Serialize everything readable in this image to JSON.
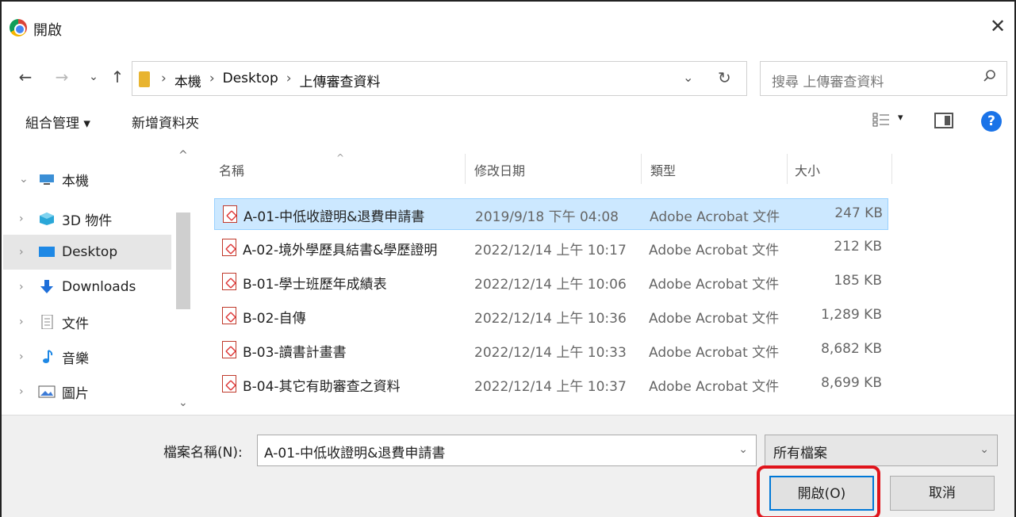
{
  "window": {
    "title": "開啟"
  },
  "address": {
    "crumbs": [
      "本機",
      "Desktop",
      "上傳審查資料"
    ],
    "separator": "›"
  },
  "search": {
    "placeholder": "搜尋 上傳審查資料"
  },
  "toolbar": {
    "organize_label": "組合管理 ▾",
    "new_folder_label": "新增資料夾"
  },
  "nav_tree": [
    {
      "label": "本機",
      "icon": "pc-icon"
    },
    {
      "label": "3D 物件",
      "icon": "cube-3d-icon"
    },
    {
      "label": "Desktop",
      "icon": "desktop-icon",
      "selected": true
    },
    {
      "label": "Downloads",
      "icon": "download-arrow-icon"
    },
    {
      "label": "文件",
      "icon": "document-icon"
    },
    {
      "label": "音樂",
      "icon": "music-note-icon"
    },
    {
      "label": "圖片",
      "icon": "picture-icon"
    }
  ],
  "columns": {
    "name": "名稱",
    "date": "修改日期",
    "type": "類型",
    "size": "大小"
  },
  "files": [
    {
      "name": "A-01-中低收證明&退費申請書",
      "date": "2019/9/18 下午 04:08",
      "type": "Adobe Acrobat 文件",
      "size": "247 KB",
      "selected": true
    },
    {
      "name": "A-02-境外學歷具結書&學歷證明",
      "date": "2022/12/14 上午 10:17",
      "type": "Adobe Acrobat 文件",
      "size": "212 KB"
    },
    {
      "name": "B-01-學士班歷年成績表",
      "date": "2022/12/14 上午 10:06",
      "type": "Adobe Acrobat 文件",
      "size": "185 KB"
    },
    {
      "name": "B-02-自傳",
      "date": "2022/12/14 上午 10:36",
      "type": "Adobe Acrobat 文件",
      "size": "1,289 KB"
    },
    {
      "name": "B-03-讀書計畫書",
      "date": "2022/12/14 上午 10:33",
      "type": "Adobe Acrobat 文件",
      "size": "8,682 KB"
    },
    {
      "name": "B-04-其它有助審查之資料",
      "date": "2022/12/14 上午 10:37",
      "type": "Adobe Acrobat 文件",
      "size": "8,699 KB"
    }
  ],
  "bottom": {
    "filename_label": "檔案名稱(N):",
    "filename_value": "A-01-中低收證明&退費申請書",
    "filetype_value": "所有檔案",
    "open_label": "開啟(O)",
    "cancel_label": "取消"
  },
  "colors": {
    "selection": "#cce8ff",
    "highlight": "#e0141b",
    "help": "#1a73e8"
  }
}
